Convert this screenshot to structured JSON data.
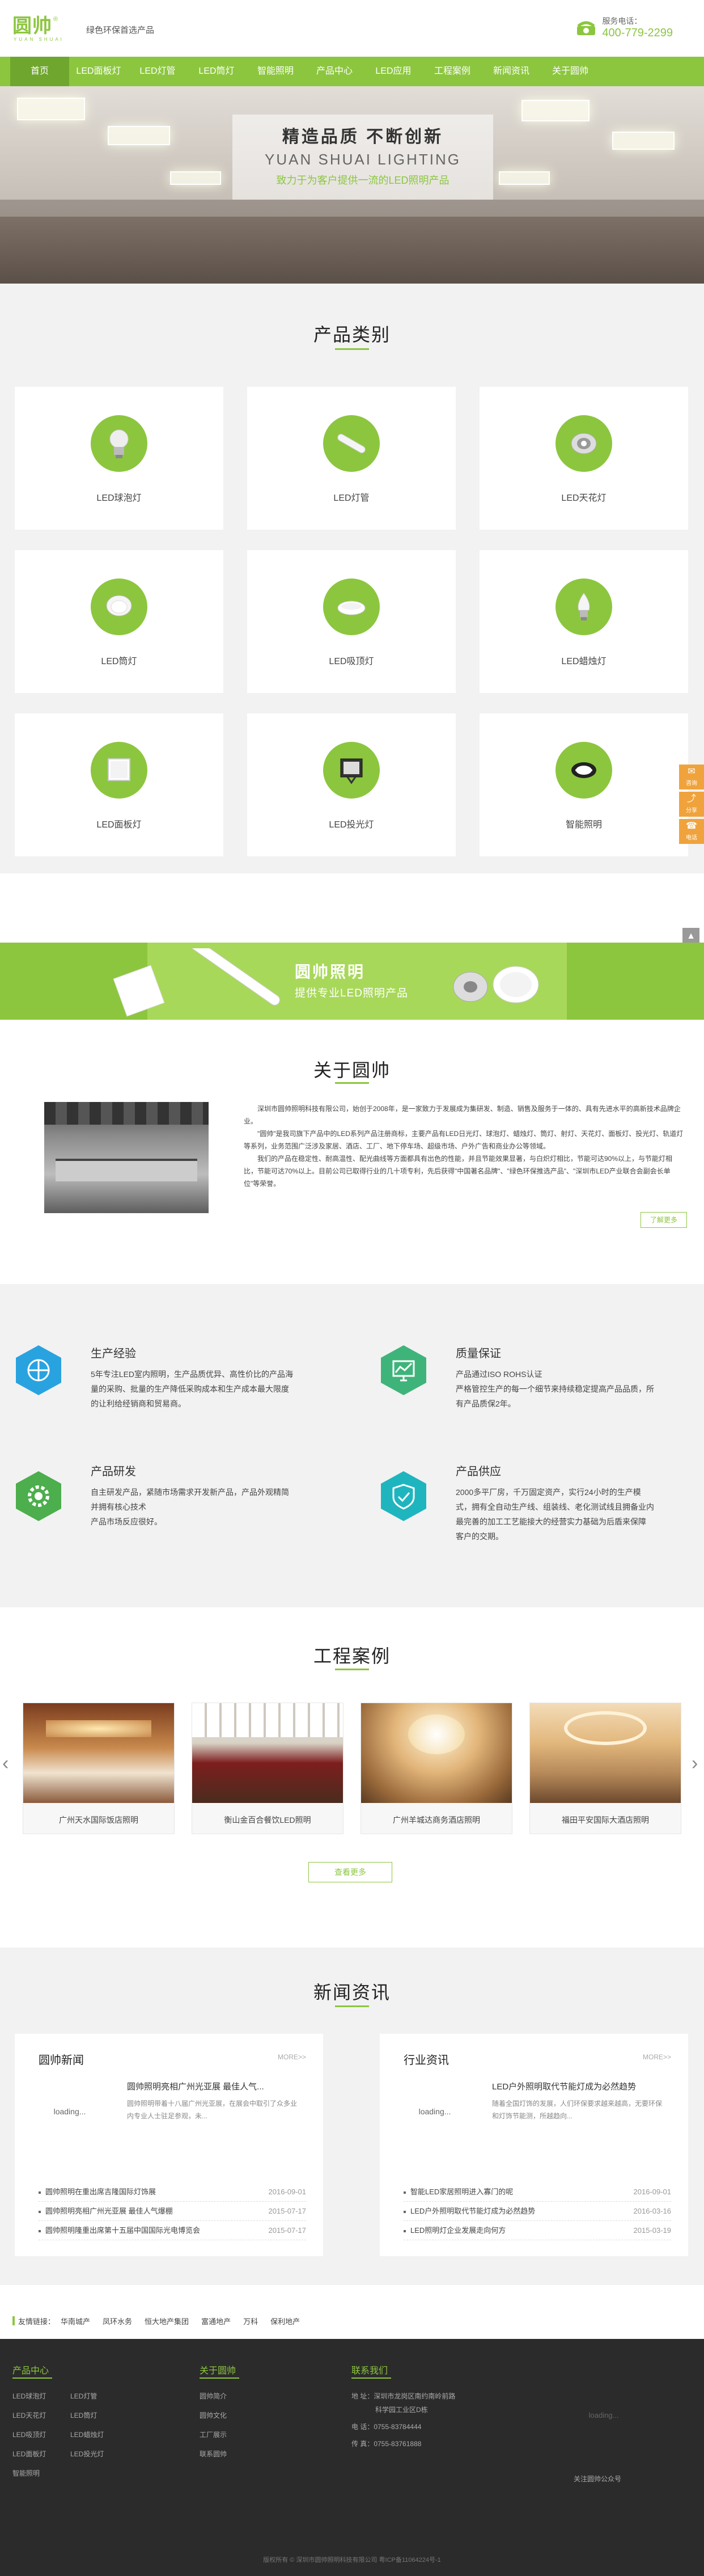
{
  "header": {
    "logo_text": "圆帅",
    "logo_reg": "®",
    "logo_en": "YUAN SHUAI",
    "slogan": "绿色环保首选产品",
    "hotline_label": "服务电话：",
    "hotline_number": "400-779-2299"
  },
  "nav": {
    "items": [
      "首页",
      "LED面板灯",
      "LED灯管",
      "LED筒灯",
      "智能照明",
      "产品中心",
      "LED应用",
      "工程案例",
      "新闻资讯",
      "关于圆帅"
    ],
    "active_index": 0
  },
  "banner": {
    "line1": "精造品质  不断创新",
    "line2": "YUAN SHUAI LIGHTING",
    "line3": "致力于为客户提供一流的LED照明产品"
  },
  "products": {
    "title": "产品类别",
    "items": [
      {
        "name": "LED球泡灯",
        "icon": "bulb-icon"
      },
      {
        "name": "LED灯管",
        "icon": "tube-icon"
      },
      {
        "name": "LED天花灯",
        "icon": "ceiling-light-icon"
      },
      {
        "name": "LED筒灯",
        "icon": "downlight-icon"
      },
      {
        "name": "LED吸顶灯",
        "icon": "ceiling-lamp-icon"
      },
      {
        "name": "LED蜡烛灯",
        "icon": "candle-bulb-icon"
      },
      {
        "name": "LED面板灯",
        "icon": "panel-light-icon"
      },
      {
        "name": "LED投光灯",
        "icon": "floodlight-icon"
      },
      {
        "name": "智能照明",
        "icon": "smart-light-icon"
      }
    ]
  },
  "side_tools": {
    "consult": "咨询",
    "share": "分享",
    "phone": "电话"
  },
  "promo": {
    "title": "圆帅照明",
    "subtitle": "提供专业LED照明产品"
  },
  "about": {
    "title": "关于圆帅",
    "paragraphs": [
      "深圳市圆帅照明科技有限公司，始创于2008年，是一家致力于发展成为集研发、制造、销售及服务于一体的、具有先进水平的高新技术品牌企业。",
      "\"圆帅\"是我司旗下产品中的LED系列产品注册商标，主要产品有LED日光灯、球泡灯、蜡烛灯、筒灯、射灯、天花灯、面板灯、投光灯、轨道灯等系列，业务范围广泛涉及家居、酒店、工厂、地下停车场、超级市场、户外广告和商业办公等领域。",
      "我们的产品在稳定性、耐高温性、配光曲线等方面都具有出色的性能，并且节能效果显著，与白炽灯相比，节能可达90%以上，与节能灯相比，节能可达70%以上。目前公司已取得行业的几十项专利，先后获得\"中国著名品牌\"、\"绿色环保推选产品\"、\"深圳市LED产业联合会副会长单位\"等荣誉。"
    ],
    "more_button": "了解更多"
  },
  "features": [
    {
      "title": "生产经验",
      "icon": "globe-icon",
      "desc": "5年专注LED室内照明，生产品质优异、高性价比的产品海\n量的采购、批量的生产降低采购成本和生产成本最大限度\n的让利给经销商和贸易商。"
    },
    {
      "title": "质量保证",
      "icon": "chart-icon",
      "desc": "产品通过ISO ROHS认证\n严格管控生产的每一个细节来持续稳定提高产品品质，所\n有产品质保2年。"
    },
    {
      "title": "产品研发",
      "icon": "gear-icon",
      "desc": "自主研发产品，紧随市场需求开发新产品，产品外观精简\n并拥有核心技术\n产品市场反应很好。"
    },
    {
      "title": "产品供应",
      "icon": "shield-check-icon",
      "desc": "2000多平厂房，千万固定资产，实行24小时的生产模\n式，拥有全自动生产线、组装线、老化测试线且拥备业内\n最完善的加工工艺能接大的经营实力基础为后盾来保障\n客户的交期。"
    }
  ],
  "cases": {
    "title": "工程案例",
    "items": [
      "广州天水国际饭店照明",
      "衡山金百合餐饮LED照明",
      "广州羊城达商务酒店照明",
      "福田平安国际大酒店照明"
    ],
    "more_button": "查看更多"
  },
  "news": {
    "title": "新闻资讯",
    "columns": [
      {
        "title": "圆帅新闻",
        "more": "MORE>>",
        "loading": "loading...",
        "featured_title": "圆帅照明亮相广州光亚展 最佳人气...",
        "featured_desc": "圆帅照明带着十八届广州光亚展，在展会中取引了众多业内专业人士驻足参观，未...",
        "list": [
          {
            "title": "圆帅照明在重出席吉隆国际灯饰展",
            "date": "2016-09-01"
          },
          {
            "title": "圆帅照明亮相广州光亚展 最佳人气爆棚",
            "date": "2015-07-17"
          },
          {
            "title": "圆帅照明隆重出席第十五届中国国际光电博览会",
            "date": "2015-07-17"
          }
        ]
      },
      {
        "title": "行业资讯",
        "more": "MORE>>",
        "loading": "loading...",
        "featured_title": "LED户外照明取代节能灯成为必然趋势",
        "featured_desc": "随着全国灯饰的发展，人们环保要求越来越高，无要环保和灯饰节能测，所越趋向...",
        "list": [
          {
            "title": "智能LED家居照明进入寡门的呢",
            "date": "2016-09-01"
          },
          {
            "title": "LED户外照明取代节能灯成为必然趋势",
            "date": "2016-03-16"
          },
          {
            "title": "LED照明灯企业发展走向何方",
            "date": "2015-03-19"
          }
        ]
      }
    ]
  },
  "friend_links": {
    "label": "友情链接：",
    "items": [
      "华南城产",
      "凤环水务",
      "恒大地产集团",
      "富通地产",
      "万科",
      "保利地产"
    ]
  },
  "footer": {
    "col1_title": "产品中心",
    "col1_links": [
      "LED球泡灯",
      "LED灯管",
      "LED天花灯",
      "LED筒灯",
      "LED吸顶灯",
      "LED蜡烛灯",
      "LED面板灯",
      "LED投光灯",
      "智能照明"
    ],
    "col2_title": "关于圆帅",
    "col2_links": [
      "圆帅简介",
      "圆帅文化",
      "工厂展示",
      "联系圆帅"
    ],
    "col3_title": "联系我们",
    "address": "地 址：深圳市龙岗区南约南岭前路",
    "address2": "科学园工业区D栋",
    "phone": "电 话：0755-83784444",
    "fax": "传 真：0755-83761888",
    "qr_loading": "loading...",
    "qr_caption": "关注圆帅公众号",
    "copyright": "版权所有 © 深圳市圆帅照明科技有限公司  粤ICP备11064224号-1"
  },
  "colors": {
    "brand_green": "#8cc63f",
    "dark_green": "#6fa62d",
    "side_orange": "#f0a33c"
  }
}
